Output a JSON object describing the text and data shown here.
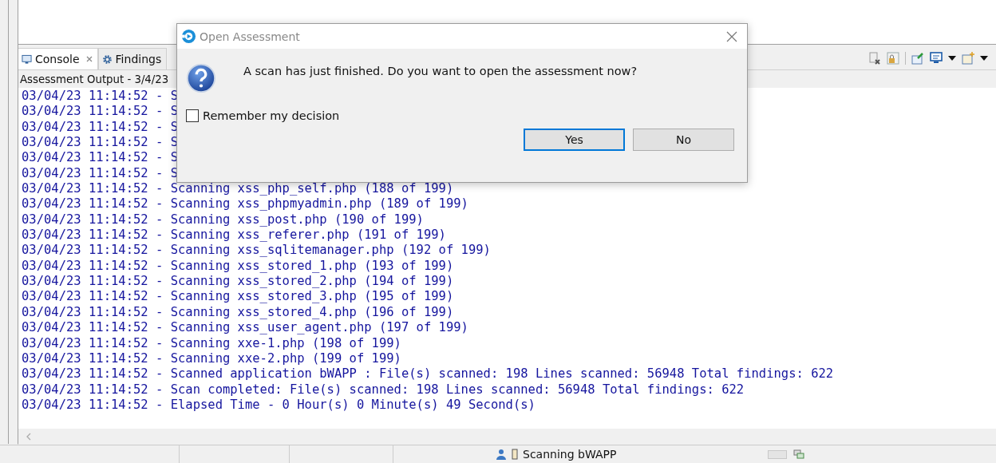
{
  "tabs": [
    {
      "label": "Console",
      "selected": true,
      "closable": true
    },
    {
      "label": "Findings",
      "selected": false,
      "closable": false
    }
  ],
  "console": {
    "header": "Assessment Output - 3/4/23",
    "lines": [
      "03/04/23 11:14:52 - S",
      "03/04/23 11:14:52 - S",
      "03/04/23 11:14:52 - S",
      "03/04/23 11:14:52 - S",
      "03/04/23 11:14:52 - S",
      "03/04/23 11:14:52 - S",
      "03/04/23 11:14:52 - Scanning xss_php_self.php (188 of 199)",
      "03/04/23 11:14:52 - Scanning xss_phpmyadmin.php (189 of 199)",
      "03/04/23 11:14:52 - Scanning xss_post.php (190 of 199)",
      "03/04/23 11:14:52 - Scanning xss_referer.php (191 of 199)",
      "03/04/23 11:14:52 - Scanning xss_sqlitemanager.php (192 of 199)",
      "03/04/23 11:14:52 - Scanning xss_stored_1.php (193 of 199)",
      "03/04/23 11:14:52 - Scanning xss_stored_2.php (194 of 199)",
      "03/04/23 11:14:52 - Scanning xss_stored_3.php (195 of 199)",
      "03/04/23 11:14:52 - Scanning xss_stored_4.php (196 of 199)",
      "03/04/23 11:14:52 - Scanning xss_user_agent.php (197 of 199)",
      "03/04/23 11:14:52 - Scanning xxe-1.php (198 of 199)",
      "03/04/23 11:14:52 - Scanning xxe-2.php (199 of 199)",
      "03/04/23 11:14:52 - Scanned application bWAPP : File(s) scanned: 198 Lines scanned: 56948 Total findings: 622",
      "03/04/23 11:14:52 - Scan completed: File(s) scanned: 198 Lines scanned: 56948 Total findings: 622",
      "03/04/23 11:14:52 - Elapsed Time - 0 Hour(s) 0 Minute(s) 49 Second(s)"
    ]
  },
  "dialog": {
    "title": "Open Assessment",
    "message": "A scan has just finished. Do you want to open the assessment now?",
    "checkbox": {
      "label": "Remember my decision",
      "checked": false
    },
    "buttons": [
      {
        "label": "Yes",
        "selected": true
      },
      {
        "label": "No",
        "selected": false
      }
    ]
  },
  "status_bar": {
    "text": "Scanning bWAPP",
    "level": 0
  }
}
